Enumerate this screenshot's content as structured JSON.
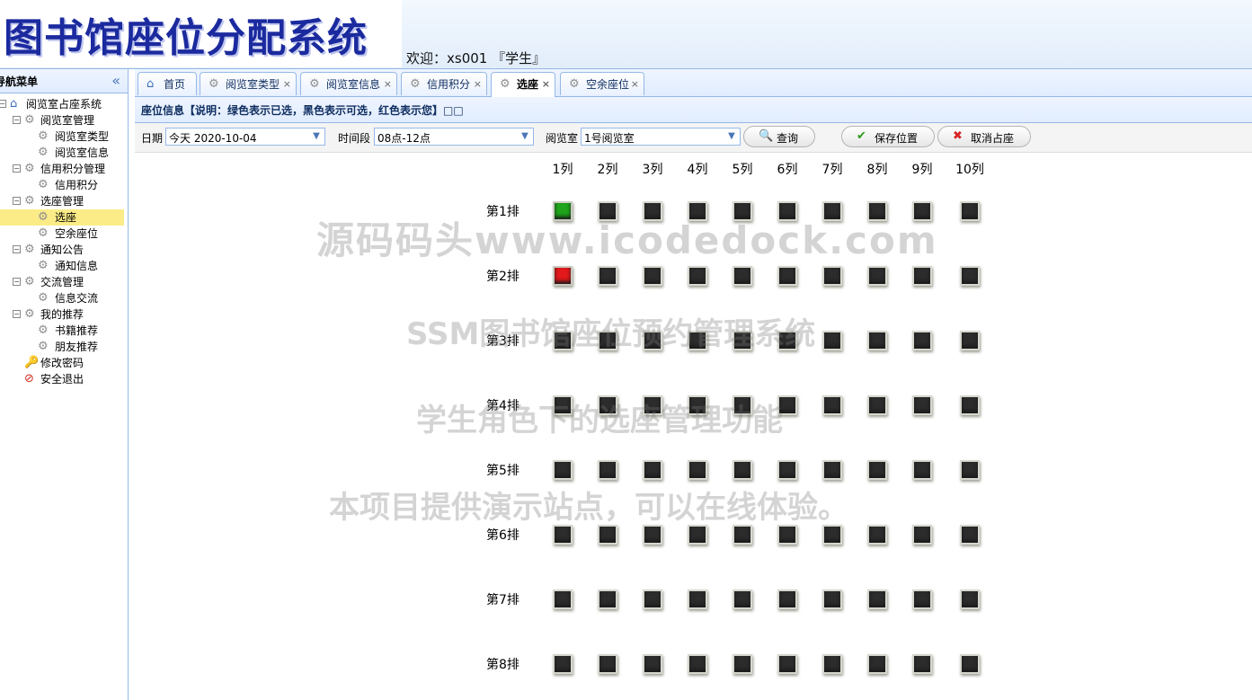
{
  "header": {
    "logo": "图书馆座位分配系统",
    "welcome": "欢迎：xs001 『学生』"
  },
  "sidebar": {
    "title": "导航菜单",
    "collapse_icon": "double-chevron-left-icon",
    "tree": [
      {
        "label": "阅览室占座系统",
        "icon": "home-icon",
        "level": 0
      },
      {
        "label": "阅览室管理",
        "icon": "gear-icon",
        "level": 1
      },
      {
        "label": "阅览室类型",
        "icon": "gear-icon",
        "level": 2
      },
      {
        "label": "阅览室信息",
        "icon": "gear-icon",
        "level": 2
      },
      {
        "label": "信用积分管理",
        "icon": "gear-icon",
        "level": 1
      },
      {
        "label": "信用积分",
        "icon": "gear-icon",
        "level": 2
      },
      {
        "label": "选座管理",
        "icon": "gear-icon",
        "level": 1
      },
      {
        "label": "选座",
        "icon": "gear-icon",
        "level": 2,
        "selected": true
      },
      {
        "label": "空余座位",
        "icon": "gear-icon",
        "level": 2
      },
      {
        "label": "通知公告",
        "icon": "gear-icon",
        "level": 1
      },
      {
        "label": "通知信息",
        "icon": "gear-icon",
        "level": 2
      },
      {
        "label": "交流管理",
        "icon": "gear-icon",
        "level": 1
      },
      {
        "label": "信息交流",
        "icon": "gear-icon",
        "level": 2
      },
      {
        "label": "我的推荐",
        "icon": "gear-icon",
        "level": 1
      },
      {
        "label": "书籍推荐",
        "icon": "gear-icon",
        "level": 2
      },
      {
        "label": "朋友推荐",
        "icon": "gear-icon",
        "level": 2
      },
      {
        "label": "修改密码",
        "icon": "key-icon",
        "level": 1
      },
      {
        "label": "安全退出",
        "icon": "exit-icon",
        "level": 1
      }
    ]
  },
  "tabs": [
    {
      "label": "首页",
      "icon": "home-icon",
      "closable": false
    },
    {
      "label": "阅览室类型",
      "icon": "gear-icon",
      "closable": true
    },
    {
      "label": "阅览室信息",
      "icon": "gear-icon",
      "closable": true
    },
    {
      "label": "信用积分",
      "icon": "gear-icon",
      "closable": true
    },
    {
      "label": "选座",
      "icon": "gear-icon",
      "closable": true,
      "active": true
    },
    {
      "label": "空余座位",
      "icon": "gear-icon",
      "closable": true
    }
  ],
  "tab_close": "×",
  "panel": {
    "title": "座位信息【说明：绿色表示已选，黑色表示可选，红色表示您】□□"
  },
  "toolbar": {
    "date_label": "日期",
    "date_value": "今天  2020-10-04",
    "time_label": "时间段",
    "time_value": "08点-12点",
    "room_label": "阅览室",
    "room_value": "1号阅览室",
    "search_label": "查询",
    "save_label": "保存位置",
    "cancel_label": "取消占座"
  },
  "seat_grid": {
    "columns": [
      "1列",
      "2列",
      "3列",
      "4列",
      "5列",
      "6列",
      "7列",
      "8列",
      "9列",
      "10列"
    ],
    "rows": [
      "第1排",
      "第2排",
      "第3排",
      "第4排",
      "第5排",
      "第6排",
      "第7排",
      "第8排"
    ],
    "status_colors": {
      "selected": "#1ea51b",
      "available": "#2c2c2c",
      "mine": "#e3191b"
    },
    "status": [
      [
        "selected",
        "available",
        "available",
        "available",
        "available",
        "available",
        "available",
        "available",
        "available",
        "available"
      ],
      [
        "mine",
        "available",
        "available",
        "available",
        "available",
        "available",
        "available",
        "available",
        "available",
        "available"
      ],
      [
        "available",
        "available",
        "available",
        "available",
        "available",
        "available",
        "available",
        "available",
        "available",
        "available"
      ],
      [
        "available",
        "available",
        "available",
        "available",
        "available",
        "available",
        "available",
        "available",
        "available",
        "available"
      ],
      [
        "available",
        "available",
        "available",
        "available",
        "available",
        "available",
        "available",
        "available",
        "available",
        "available"
      ],
      [
        "available",
        "available",
        "available",
        "available",
        "available",
        "available",
        "available",
        "available",
        "available",
        "available"
      ],
      [
        "available",
        "available",
        "available",
        "available",
        "available",
        "available",
        "available",
        "available",
        "available",
        "available"
      ],
      [
        "available",
        "available",
        "available",
        "available",
        "available",
        "available",
        "available",
        "available",
        "available",
        "available"
      ]
    ]
  },
  "watermarks": [
    "源码码头www.icodedock.com",
    "SSM图书馆座位预约管理系统",
    "学生角色下的选座管理功能",
    "本项目提供演示站点，可以在线体验。"
  ]
}
